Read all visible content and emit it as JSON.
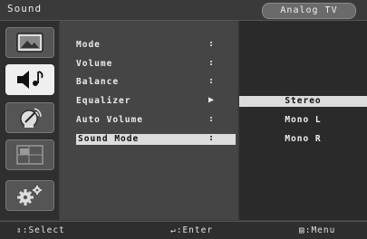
{
  "header": {
    "title": "Sound",
    "source": "Analog TV"
  },
  "sidebar": [
    {
      "icon": "picture-icon",
      "selected": false
    },
    {
      "icon": "sound-icon",
      "selected": true
    },
    {
      "icon": "channel-icon",
      "selected": false
    },
    {
      "icon": "pip-icon",
      "selected": false
    },
    {
      "icon": "setup-icon",
      "selected": false
    }
  ],
  "menu": {
    "items": [
      {
        "label": "Mode",
        "mark": ":"
      },
      {
        "label": "Volume",
        "mark": ":"
      },
      {
        "label": "Balance",
        "mark": ":"
      },
      {
        "label": "Equalizer",
        "mark": "▶"
      },
      {
        "label": "Auto Volume",
        "mark": ":"
      },
      {
        "label": "Sound Mode",
        "mark": ":"
      }
    ],
    "selected_index": 5
  },
  "options": {
    "items": [
      "Stereo",
      "Mono L",
      "Mono R"
    ],
    "selected_index": 0
  },
  "footer": {
    "select": "⇕:Select",
    "enter": "↵:Enter",
    "menu": "▤:Menu"
  }
}
